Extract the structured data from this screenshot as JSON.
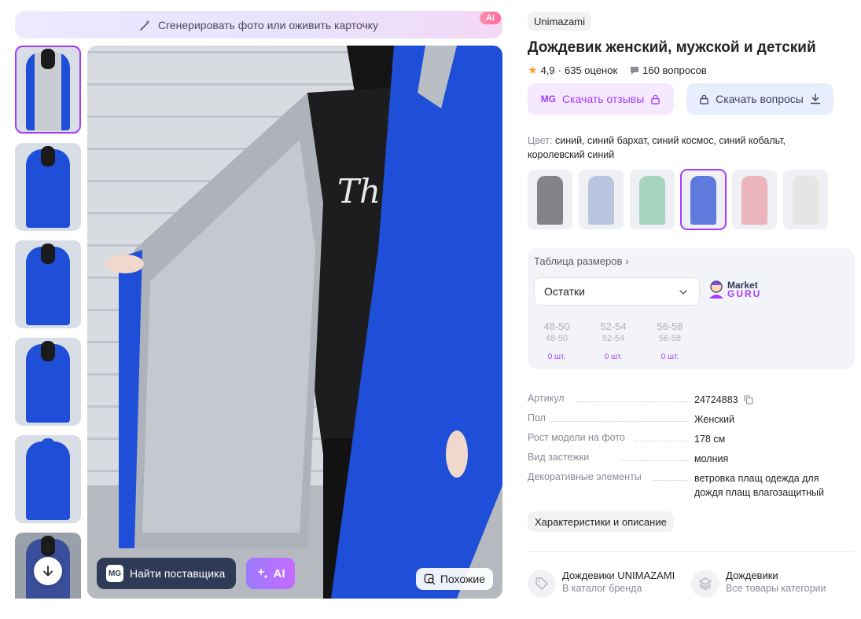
{
  "gallery": {
    "ai_banner": "Сгенерировать фото или оживить карточку",
    "ai_badge": "AI",
    "find_supplier": "Найти поставщика",
    "mg_logo": "MG",
    "ai_button": "AI",
    "similar": "Похожие"
  },
  "product": {
    "brand": "Unimazami",
    "title": "Дождевик женский, мужской и детский",
    "rating": "4,9",
    "reviews_count": "635 оценок",
    "questions_count": "160 вопросов",
    "download_reviews": "Скачать отзывы",
    "download_questions": "Скачать вопросы",
    "color_label": "Цвет:",
    "color_values": "синий, синий бархат, синий космос, синий кобальт, королевский синий",
    "swatch_colors": [
      "#5c5f66",
      "#a8b6d8",
      "#8fc9b0",
      "#2f52d6",
      "#e9a0a8",
      "#e2e2e2"
    ]
  },
  "sizes": {
    "table_link": "Таблица размеров",
    "select_value": "Остатки",
    "market": "Market",
    "guru": "GURU",
    "items": [
      {
        "size": "48-50",
        "ru": "48-50",
        "stock": "0 шт."
      },
      {
        "size": "52-54",
        "ru": "52-54",
        "stock": "0 шт."
      },
      {
        "size": "56-58",
        "ru": "56-58",
        "stock": "0 шт."
      }
    ]
  },
  "specs": [
    {
      "key": "Артикул",
      "value": "24724883"
    },
    {
      "key": "Пол",
      "value": "Женский"
    },
    {
      "key": "Рост модели на фото",
      "value": "178 см"
    },
    {
      "key": "Вид застежки",
      "value": "молния"
    },
    {
      "key": "Декоративные элементы",
      "value": "ветровка плащ одежда для дождя плащ влагозащитный"
    }
  ],
  "chars_button": "Характеристики и описание",
  "links": [
    {
      "title": "Дождевики UNIMAZAMI",
      "subtitle": "В каталог бренда"
    },
    {
      "title": "Дождевики",
      "subtitle": "Все товары категории"
    }
  ],
  "colors": {
    "accent": "#a73afd",
    "coat_blue": "#1f4fd8"
  }
}
